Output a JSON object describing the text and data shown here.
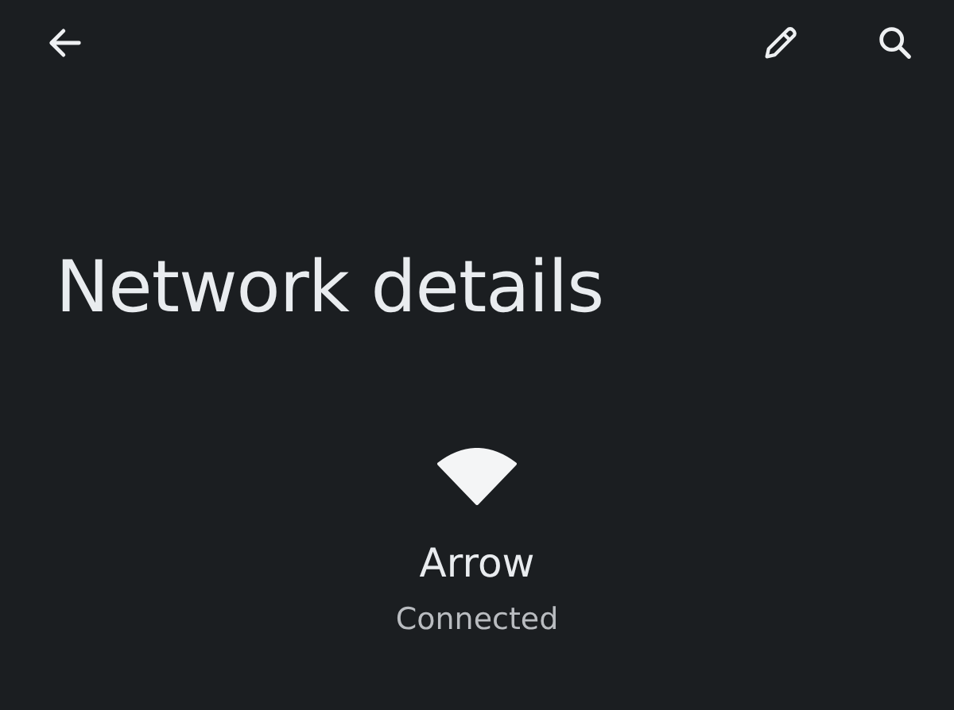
{
  "title": "Network details",
  "network": {
    "name": "Arrow",
    "status": "Connected"
  }
}
